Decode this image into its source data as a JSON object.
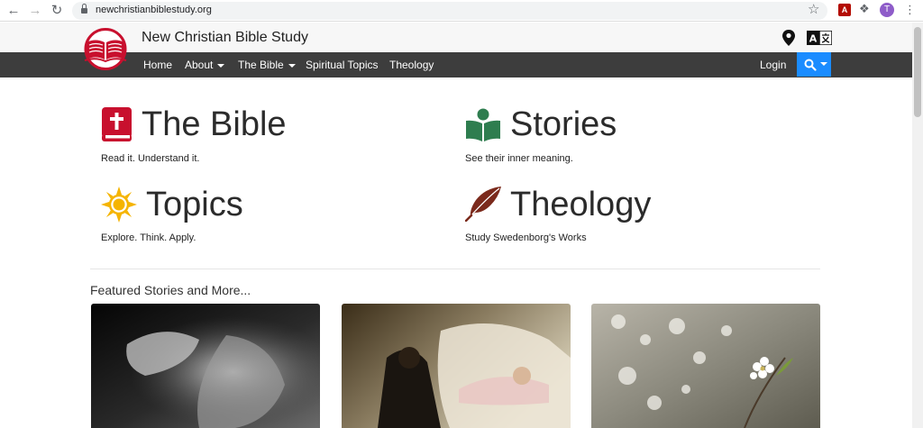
{
  "browser": {
    "url": "newchristianbiblestudy.org",
    "back_icon": "arrow-left-icon",
    "forward_icon": "arrow-right-icon",
    "reload_icon": "reload-icon",
    "profile_initial": "T"
  },
  "header": {
    "site_title": "New Christian Bible Study"
  },
  "nav": {
    "items": [
      {
        "label": "Home"
      },
      {
        "label": "About"
      },
      {
        "label": "The Bible"
      },
      {
        "label": "Spiritual Topics"
      },
      {
        "label": "Theology"
      }
    ],
    "login": "Login"
  },
  "sections": [
    {
      "title": "The Bible",
      "subtitle": "Read it. Understand it.",
      "icon": "bible-book-icon",
      "color": "#c8102e"
    },
    {
      "title": "Stories",
      "subtitle": "See their inner meaning.",
      "icon": "person-reading-icon",
      "color": "#2e7d4f"
    },
    {
      "title": "Topics",
      "subtitle": "Explore. Think. Apply.",
      "icon": "sun-icon",
      "color": "#f5b400"
    },
    {
      "title": "Theology",
      "subtitle": "Study Swedenborg's Works",
      "icon": "quill-icon",
      "color": "#7b2a1c"
    }
  ],
  "featured": {
    "title": "Featured Stories and More..."
  },
  "colors": {
    "nav_bg": "#3d3d3d",
    "search_bg": "#1a8cff",
    "logo_red": "#c8102e"
  }
}
